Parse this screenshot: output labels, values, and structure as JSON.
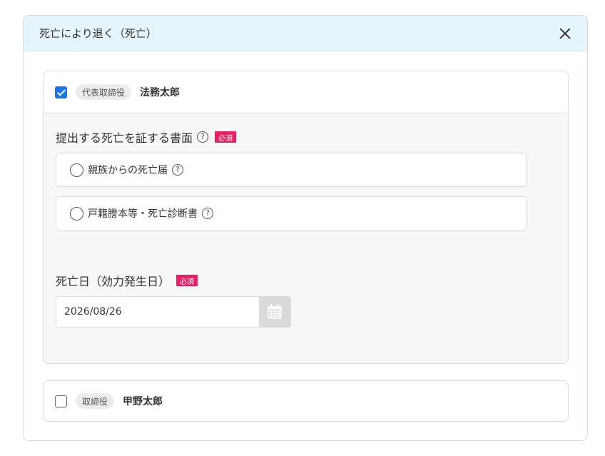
{
  "modal": {
    "title": "死亡により退く（死亡）"
  },
  "officer_1": {
    "checked": true,
    "role": "代表取締役",
    "name": "法務太郎",
    "document_section": {
      "label": "提出する死亡を証する書面",
      "required": "必須",
      "options": [
        {
          "label": "親族からの死亡届"
        },
        {
          "label": "戸籍謄本等・死亡診断書"
        }
      ]
    },
    "date_section": {
      "label": "死亡日（効力発生日）",
      "required": "必須",
      "value": "2026/08/26"
    }
  },
  "officer_2": {
    "checked": false,
    "role": "取締役",
    "name": "甲野太郎"
  },
  "icons": {
    "close": "close-icon",
    "help": "question-circle-icon",
    "calendar": "calendar-icon"
  },
  "colors": {
    "header_bg": "#e5f5fb",
    "checkbox_checked": "#1a73e8",
    "required_badge": "#e91e63"
  }
}
